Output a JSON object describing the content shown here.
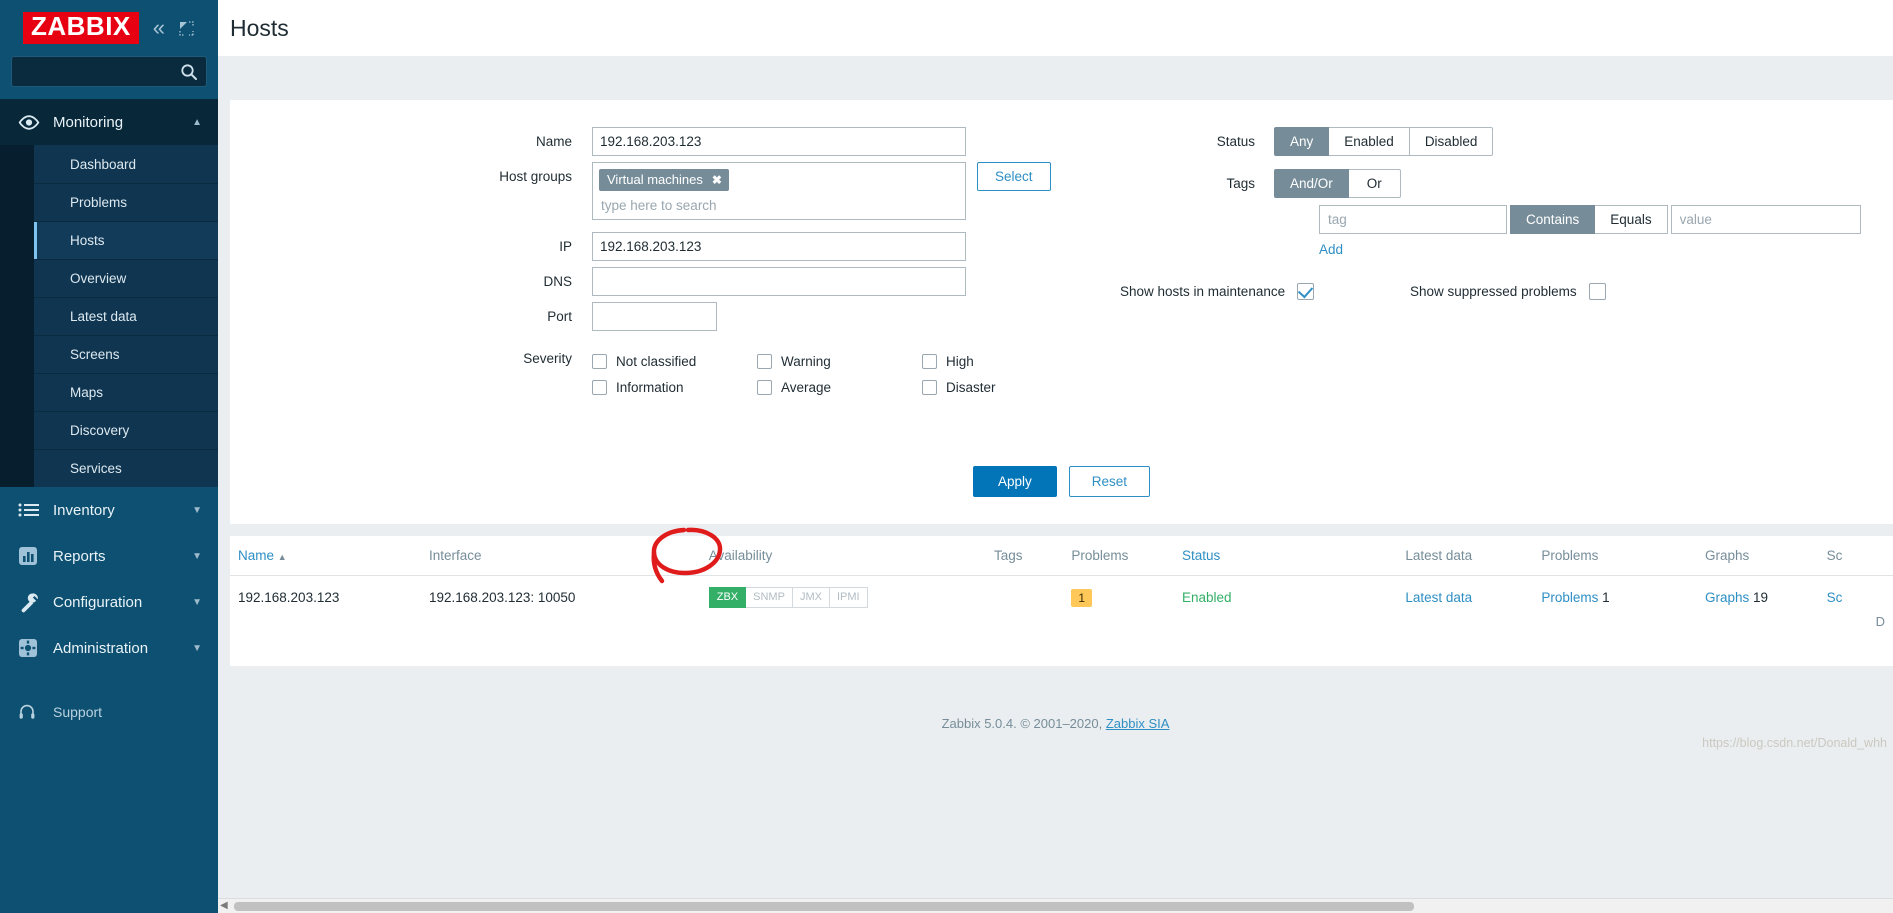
{
  "brand": {
    "logo_text": "ZABBIX",
    "logo_bg": "#e60012"
  },
  "sidebar": {
    "collapse_icon": "chevron-double-left-icon",
    "expand_icon": "expand-arrow-icon",
    "search": {
      "value": "",
      "placeholder": "",
      "icon": "search-icon"
    },
    "sections": [
      {
        "label": "Monitoring",
        "icon": "eye-icon",
        "expanded": true,
        "chevron": "chevron-up-icon",
        "items": [
          {
            "label": "Dashboard",
            "selected": false
          },
          {
            "label": "Problems",
            "selected": false
          },
          {
            "label": "Hosts",
            "selected": true
          },
          {
            "label": "Overview",
            "selected": false
          },
          {
            "label": "Latest data",
            "selected": false
          },
          {
            "label": "Screens",
            "selected": false
          },
          {
            "label": "Maps",
            "selected": false
          },
          {
            "label": "Discovery",
            "selected": false
          },
          {
            "label": "Services",
            "selected": false
          }
        ]
      },
      {
        "label": "Inventory",
        "icon": "list-icon",
        "expanded": false,
        "chevron": "chevron-down-icon"
      },
      {
        "label": "Reports",
        "icon": "bar-chart-icon",
        "expanded": false,
        "chevron": "chevron-down-icon"
      },
      {
        "label": "Configuration",
        "icon": "wrench-icon",
        "expanded": false,
        "chevron": "chevron-down-icon"
      },
      {
        "label": "Administration",
        "icon": "gear-icon",
        "expanded": false,
        "chevron": "chevron-down-icon"
      }
    ],
    "support": {
      "label": "Support",
      "icon": "headset-icon"
    }
  },
  "header": {
    "title": "Hosts"
  },
  "filter": {
    "name": {
      "label": "Name",
      "value": "192.168.203.123",
      "placeholder": ""
    },
    "host_groups": {
      "label": "Host groups",
      "chips": [
        "Virtual machines"
      ],
      "chip_remove_icon": "close-icon",
      "placeholder": "type here to search",
      "select_button": "Select"
    },
    "ip": {
      "label": "IP",
      "value": "192.168.203.123",
      "placeholder": ""
    },
    "dns": {
      "label": "DNS",
      "value": "",
      "placeholder": ""
    },
    "port": {
      "label": "Port",
      "value": "",
      "placeholder": ""
    },
    "severity": {
      "label": "Severity",
      "options": [
        {
          "label": "Not classified",
          "checked": false
        },
        {
          "label": "Warning",
          "checked": false
        },
        {
          "label": "High",
          "checked": false
        },
        {
          "label": "Information",
          "checked": false
        },
        {
          "label": "Average",
          "checked": false
        },
        {
          "label": "Disaster",
          "checked": false
        }
      ]
    },
    "status": {
      "label": "Status",
      "options": [
        "Any",
        "Enabled",
        "Disabled"
      ],
      "selected": "Any"
    },
    "tags": {
      "label": "Tags",
      "operator_options": [
        "And/Or",
        "Or"
      ],
      "operator_selected": "And/Or",
      "tag_placeholder": "tag",
      "tag_value": "",
      "match_options": [
        "Contains",
        "Equals"
      ],
      "match_selected": "Contains",
      "value_placeholder": "value",
      "value_value": "",
      "add_label": "Add"
    },
    "show_maintenance": {
      "label": "Show hosts in maintenance",
      "checked": true
    },
    "show_suppressed": {
      "label": "Show suppressed problems",
      "checked": false
    },
    "apply_label": "Apply",
    "reset_label": "Reset"
  },
  "table": {
    "columns": [
      {
        "key": "name",
        "label": "Name",
        "sorted": true,
        "sort_icon": "sort-asc-icon",
        "link": true
      },
      {
        "key": "iface",
        "label": "Interface",
        "link": false
      },
      {
        "key": "avail",
        "label": "Availability",
        "link": false
      },
      {
        "key": "tags",
        "label": "Tags",
        "link": false
      },
      {
        "key": "prob1",
        "label": "Problems",
        "link": false
      },
      {
        "key": "status",
        "label": "Status",
        "link": true
      },
      {
        "key": "latest",
        "label": "Latest data",
        "link": false
      },
      {
        "key": "prob2",
        "label": "Problems",
        "link": false
      },
      {
        "key": "graphs",
        "label": "Graphs",
        "link": false
      },
      {
        "key": "screens",
        "label": "Sc",
        "link": false
      }
    ],
    "rows": [
      {
        "name": "192.168.203.123",
        "iface": "192.168.203.123: 10050",
        "availability": [
          {
            "label": "ZBX",
            "state": "ok"
          },
          {
            "label": "SNMP",
            "state": "unknown"
          },
          {
            "label": "JMX",
            "state": "unknown"
          },
          {
            "label": "IPMI",
            "state": "unknown"
          }
        ],
        "tags": "",
        "problems_badge": "1",
        "status": "Enabled",
        "latest_data": "Latest data",
        "problems_link": "Problems",
        "problems_count": "1",
        "graphs_link": "Graphs",
        "graphs_count": "19",
        "screens_link": "Sc"
      }
    ],
    "footer_text": "D"
  },
  "annotation": {
    "shape": "hand-drawn-red-circle",
    "color": "#e01b1b",
    "target": "ZBX availability badge"
  },
  "footer": {
    "text": "Zabbix 5.0.4. © 2001–2020, ",
    "link": "Zabbix SIA",
    "watermark": "https://blog.csdn.net/Donald_whh"
  },
  "colors": {
    "sidebar_bg": "#0d5071",
    "sidebar_sub_bg": "#0f3550",
    "accent_link": "#2e8fc4",
    "status_ok": "#34af67",
    "badge_warning": "#ffc859",
    "segment_active": "#768d99",
    "brand_red": "#e60012"
  }
}
